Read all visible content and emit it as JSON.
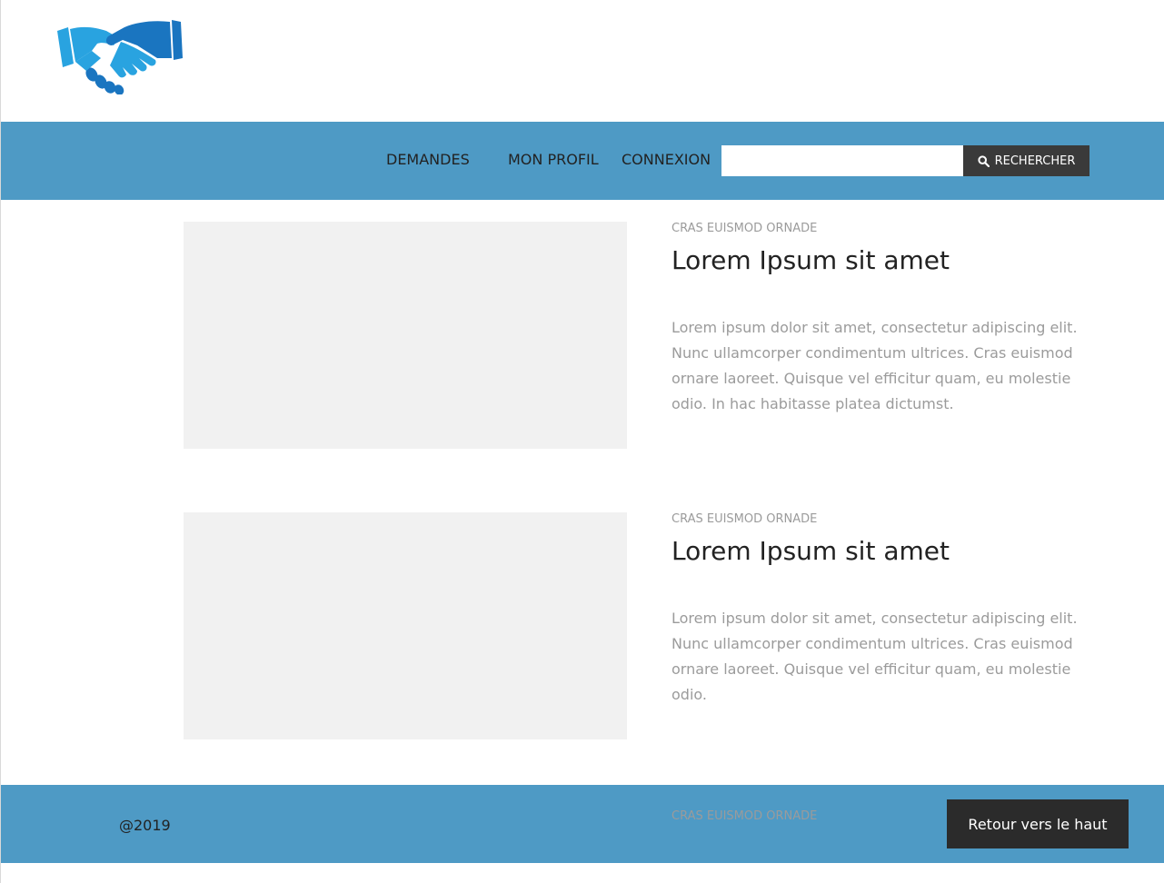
{
  "logo": {
    "icon": "handshake-icon",
    "colors": [
      "#29a3e0",
      "#1a75c0"
    ]
  },
  "nav": {
    "items": [
      {
        "label": "DEMANDES"
      },
      {
        "label": "MON PROFIL"
      },
      {
        "label": "CONNEXION"
      }
    ],
    "search": {
      "value": "",
      "placeholder": "",
      "button_label": "RECHERCHER",
      "button_icon": "search-icon"
    }
  },
  "articles": [
    {
      "category": "CRAS EUISMOD ORNADE",
      "title": "Lorem Ipsum sit amet",
      "text": "Lorem ipsum dolor sit amet, consectetur adipiscing elit. Nunc ullamcorper condimentum ultrices. Cras euismod ornare laoreet. Quisque vel efficitur quam, eu molestie odio. In hac habitasse platea dictumst."
    },
    {
      "category": "CRAS EUISMOD ORNADE",
      "title": "Lorem Ipsum sit amet",
      "text": "Lorem ipsum dolor sit amet, consectetur adipiscing elit. Nunc ullamcorper condimentum ultrices. Cras euismod ornare laoreet. Quisque vel efficitur quam, eu molestie odio."
    }
  ],
  "footer": {
    "copyright": "@2019",
    "category": "CRAS EUISMOD ORNADE",
    "back_to_top_label": "Retour vers le haut"
  },
  "colors": {
    "bar": "#4e9ac5",
    "dark_button": "#2b2b2b",
    "placeholder_image": "#f1f1f1"
  }
}
